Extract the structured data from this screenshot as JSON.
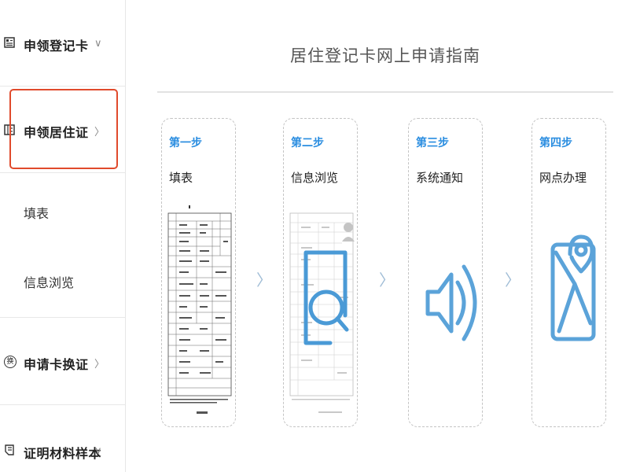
{
  "sidebar": {
    "items": [
      {
        "label": "申领登记卡",
        "arrow": "∨",
        "icon": "register-card-icon"
      },
      {
        "label": "申领居住证",
        "arrow": "〉",
        "icon": "residence-permit-icon"
      },
      {
        "label": "申请卡换证",
        "arrow": "〉",
        "icon": "exchange-icon"
      },
      {
        "label": "证明材料样本",
        "arrow": "∨",
        "icon": "document-sample-icon"
      }
    ],
    "sub_items": [
      "填表",
      "信息浏览"
    ],
    "exchange_icon_glyph": "换"
  },
  "main": {
    "title": "居住登记卡网上申请指南",
    "steps": [
      {
        "num": "第一步",
        "name": "填表",
        "icon": "form-document"
      },
      {
        "num": "第二步",
        "name": "信息浏览",
        "icon": "magnifier-icon"
      },
      {
        "num": "第三步",
        "name": "系统通知",
        "icon": "speaker-icon"
      },
      {
        "num": "第四步",
        "name": "网点办理",
        "icon": "map-location-icon"
      }
    ]
  },
  "colors": {
    "accent": "#2a8de0",
    "icon_blue": "#5ba3d9",
    "highlight": "#e04a2c"
  }
}
